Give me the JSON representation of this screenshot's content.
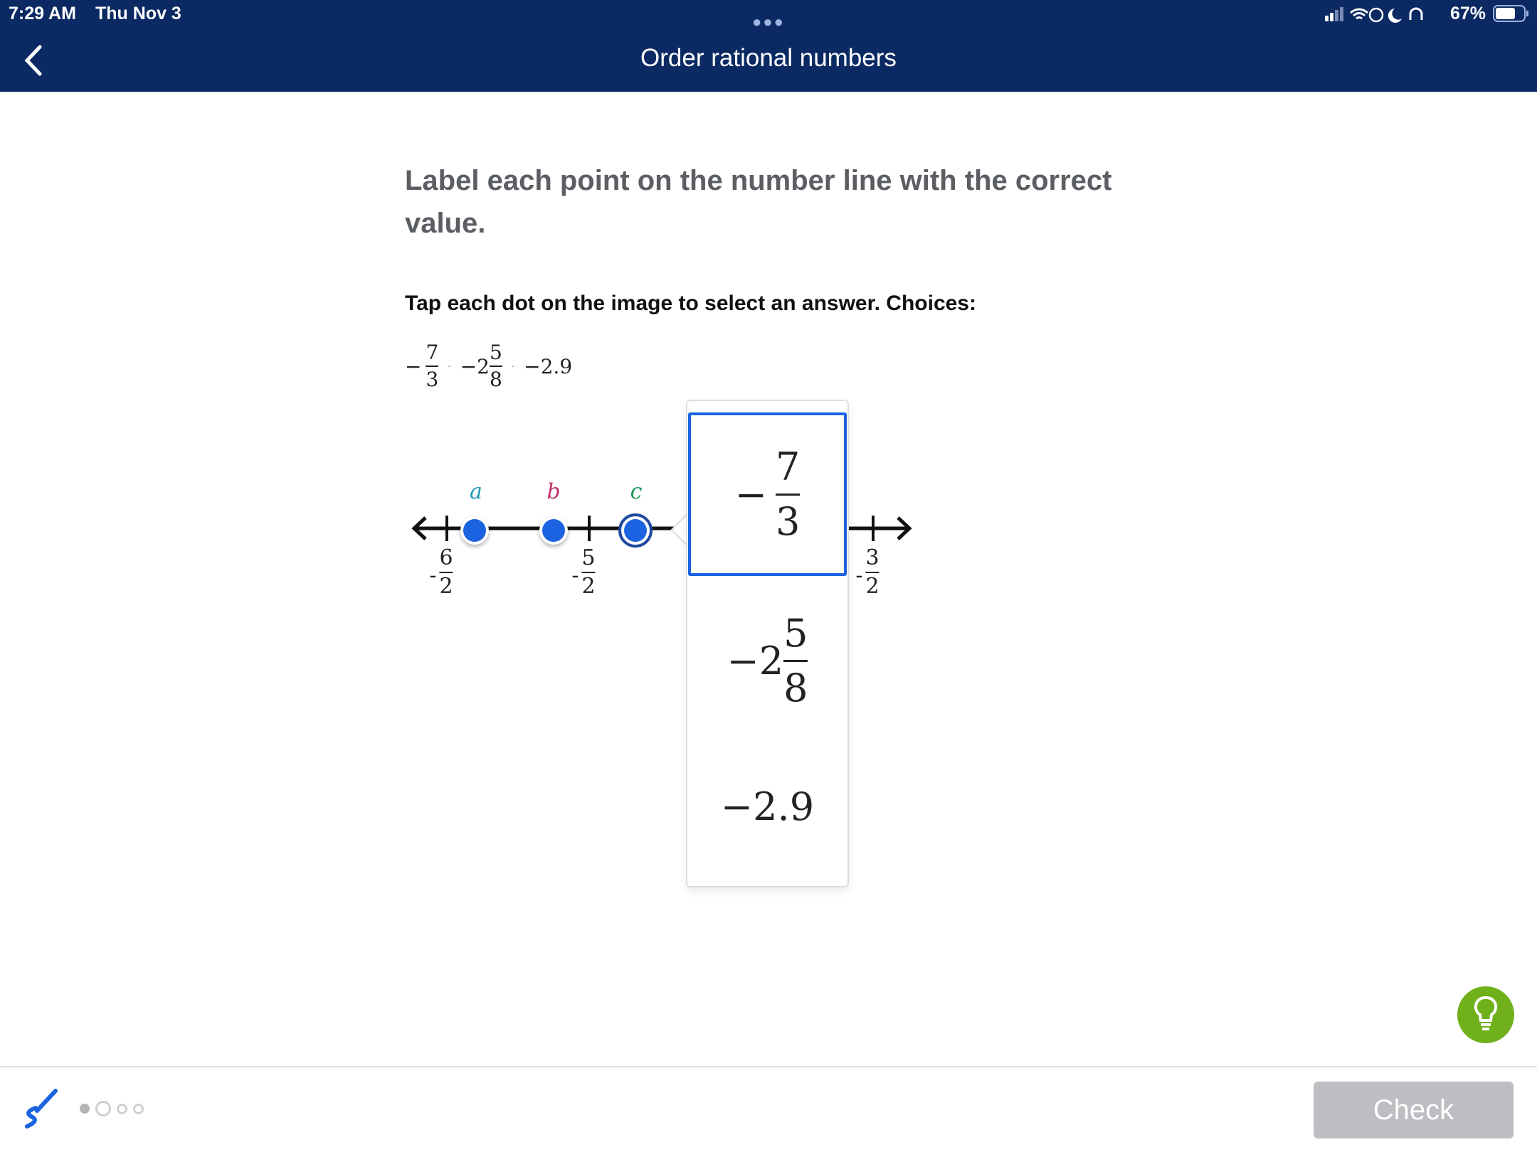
{
  "status_bar": {
    "time": "7:29 AM",
    "date": "Thu Nov 3",
    "battery": "67%"
  },
  "header": {
    "title": "Order rational numbers",
    "back_icon": "chevron-left-icon"
  },
  "question": {
    "heading": "Label each point on the number line with the correct value.",
    "instruction": "Tap each dot on the image to select an answer. Choices:"
  },
  "choices": [
    {
      "sign": "−",
      "whole": "",
      "num": "7",
      "den": "3"
    },
    {
      "sign": "−",
      "whole": "2",
      "num": "5",
      "den": "8"
    },
    {
      "sign": "−",
      "whole": "2.9",
      "num": "",
      "den": ""
    }
  ],
  "number_line": {
    "points": [
      {
        "label": "a",
        "color": "#1a9bb5",
        "value_selected": false
      },
      {
        "label": "b",
        "color": "#c2306c"
      },
      {
        "label": "c",
        "color": "#1e9a56",
        "active": true
      }
    ],
    "ticks": [
      {
        "sign": "-",
        "num": "6",
        "den": "2"
      },
      {
        "sign": "-",
        "num": "5",
        "den": "2"
      },
      {
        "sign": "-",
        "num": "3",
        "den": "2"
      }
    ],
    "dot_color": "#1b63e0"
  },
  "dropdown": {
    "selected_index": 0,
    "accent": "#1b63e0"
  },
  "footer": {
    "check_label": "Check",
    "progress_total": 4,
    "progress_current": 1,
    "hint_color": "#6fb01b"
  }
}
